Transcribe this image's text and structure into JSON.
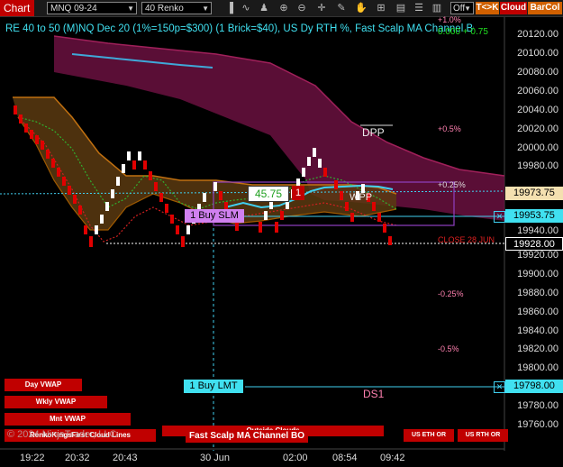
{
  "toolbar": {
    "chart_tab": "Chart",
    "instrument": "MNQ 09-24",
    "bar_type": "40 Renko",
    "off_select": "Off",
    "tk_button": "T<>K",
    "cloud_button": "Cloud",
    "barcol_button": "BarCol"
  },
  "header": {
    "indicator_title": "RE 40 to 50 (M)NQ Dec 20 (1%=150p=$300) (1 Brick=$40), US Dy RTH %, Fast Scalp MA Channel BO",
    "top_right_value": "0.000 + 0.75",
    "top_pct": "+1.0%"
  },
  "price_axis": {
    "labels": [
      "20120.00",
      "20100.00",
      "20080.00",
      "20060.00",
      "20040.00",
      "20020.00",
      "20000.00",
      "19980.00",
      "19940.00",
      "19920.00",
      "19900.00",
      "19880.00",
      "19860.00",
      "19840.00",
      "19820.00",
      "19800.00",
      "19780.00",
      "19760.00"
    ],
    "box_current": "19973.75",
    "box_order": "19953.75",
    "box_close": "19928.00",
    "box_limit": "19798.00"
  },
  "time_axis": [
    "19:22",
    "20:32",
    "20:43",
    "30 Jun",
    "02:00",
    "08:54",
    "09:42"
  ],
  "annotations": {
    "dpp": "DPP",
    "wpp": "WPP",
    "ds1": "DS1",
    "pct_p05": "+0.5%",
    "pct_p025": "+0.25%",
    "pct_m025": "-0.25%",
    "pct_m05": "-0.5%",
    "close_28_jun": "CLOSE 28 JUN",
    "price_tag": "45.75",
    "qty_tag": "1",
    "buy_slm": "1 Buy SLM",
    "buy_lmt": "1 Buy LMT",
    "copyright": "© 2024 NinjaTrader, LLC"
  },
  "bottom_buttons": {
    "day_vwap": "Day VWAP",
    "wkly_vwap": "Wkly VWAP",
    "mnt_vwap": "Mnt VWAP",
    "renko_kings": "RenkoKingsFirst Cloud Lines",
    "outside_clouds": "Outside Clouds",
    "fast_scalp": "Fast Scalp MA Channel BO",
    "us_eth": "US ETH OR",
    "us_rth": "US RTH OR"
  },
  "colors": {
    "background": "#000000",
    "bull_brick": "#ffffff",
    "bear_brick": "#e00000",
    "cloud_magenta": "#6a1040",
    "cloud_orange": "#a05a00",
    "cyan_line": "#40d0f0",
    "accent_red": "#c00000",
    "current_price_bg": "#f4e0b0"
  }
}
